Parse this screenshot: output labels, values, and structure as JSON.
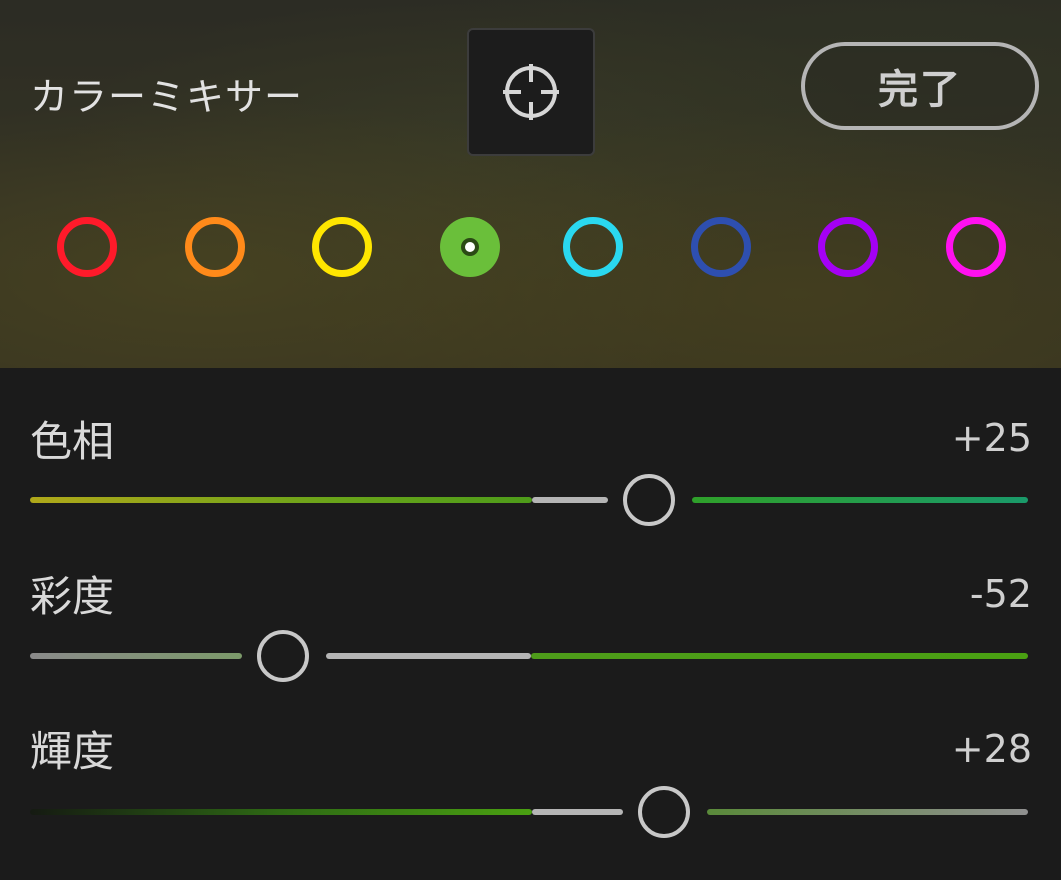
{
  "header": {
    "title": "カラーミキサー",
    "done_label": "完了",
    "target_icon": "crosshair-target-icon"
  },
  "colors": [
    {
      "name": "red",
      "hex": "#ff1a2a",
      "selected": false
    },
    {
      "name": "orange",
      "hex": "#ff8a1a",
      "selected": false
    },
    {
      "name": "yellow",
      "hex": "#ffe600",
      "selected": false
    },
    {
      "name": "green",
      "hex": "#6abf3a",
      "selected": true
    },
    {
      "name": "aqua",
      "hex": "#2ad8f0",
      "selected": false
    },
    {
      "name": "blue",
      "hex": "#2e4fb0",
      "selected": false
    },
    {
      "name": "purple",
      "hex": "#a400f5",
      "selected": false
    },
    {
      "name": "magenta",
      "hex": "#ff10f0",
      "selected": false
    }
  ],
  "sliders": [
    {
      "key": "hue",
      "label": "色相",
      "value": "+25",
      "numeric": 25,
      "min": -100,
      "max": 100
    },
    {
      "key": "saturation",
      "label": "彩度",
      "value": "-52",
      "numeric": -52,
      "min": -100,
      "max": 100
    },
    {
      "key": "luminance",
      "label": "輝度",
      "value": "+28",
      "numeric": 28,
      "min": -100,
      "max": 100
    }
  ]
}
